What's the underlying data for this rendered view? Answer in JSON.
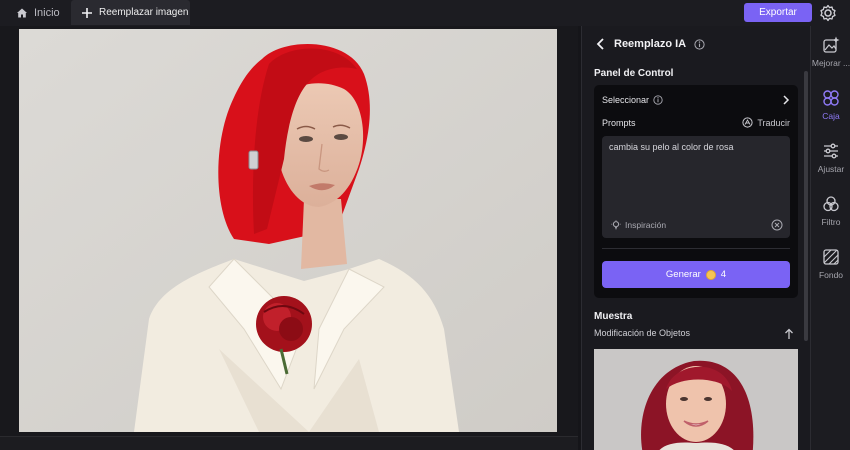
{
  "topbar": {
    "home_label": "Inicio",
    "tab_label": "Reemplazar imagen",
    "export_label": "Exportar"
  },
  "panel": {
    "title": "Reemplazo IA",
    "control_title": "Panel de Control",
    "select_label": "Seleccionar",
    "prompts_label": "Prompts",
    "translate_label": "Traducir",
    "prompt_value": "cambia su pelo al color de rosa",
    "inspiration_label": "Inspiración",
    "generate_label": "Generar",
    "generate_cost": "4",
    "sample_title": "Muestra",
    "sample_subtitle": "Modificación de Objetos"
  },
  "sidebar": {
    "items": [
      {
        "label": "Mejorar ...",
        "icon": "enhance-icon"
      },
      {
        "label": "Caja",
        "icon": "circles-icon"
      },
      {
        "label": "Ajustar",
        "icon": "sliders-icon"
      },
      {
        "label": "Filtro",
        "icon": "filter-icon"
      },
      {
        "label": "Fondo",
        "icon": "background-icon"
      }
    ]
  },
  "colors": {
    "accent": "#7a63f4",
    "hair_red": "#d8101a",
    "panel_bg": "#1a1a1f"
  }
}
